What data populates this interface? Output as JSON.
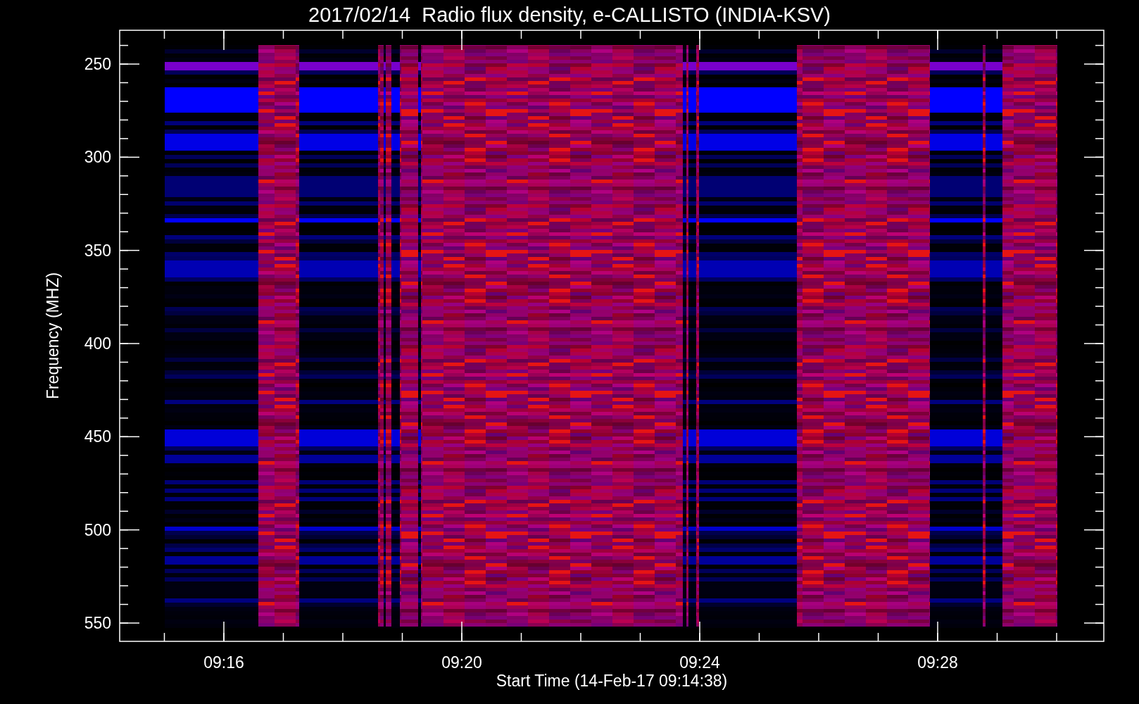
{
  "title": "2017/02/14  Radio flux density, e-CALLISTO (INDIA-KSV)",
  "y_axis": {
    "label": "Frequency (MHZ)",
    "ticks": [
      "250",
      "300",
      "350",
      "400",
      "450",
      "500",
      "550"
    ]
  },
  "x_axis": {
    "label": "Start Time (14-Feb-17 09:14:38)",
    "ticks": [
      "09:16",
      "09:20",
      "09:24",
      "09:28"
    ]
  }
}
